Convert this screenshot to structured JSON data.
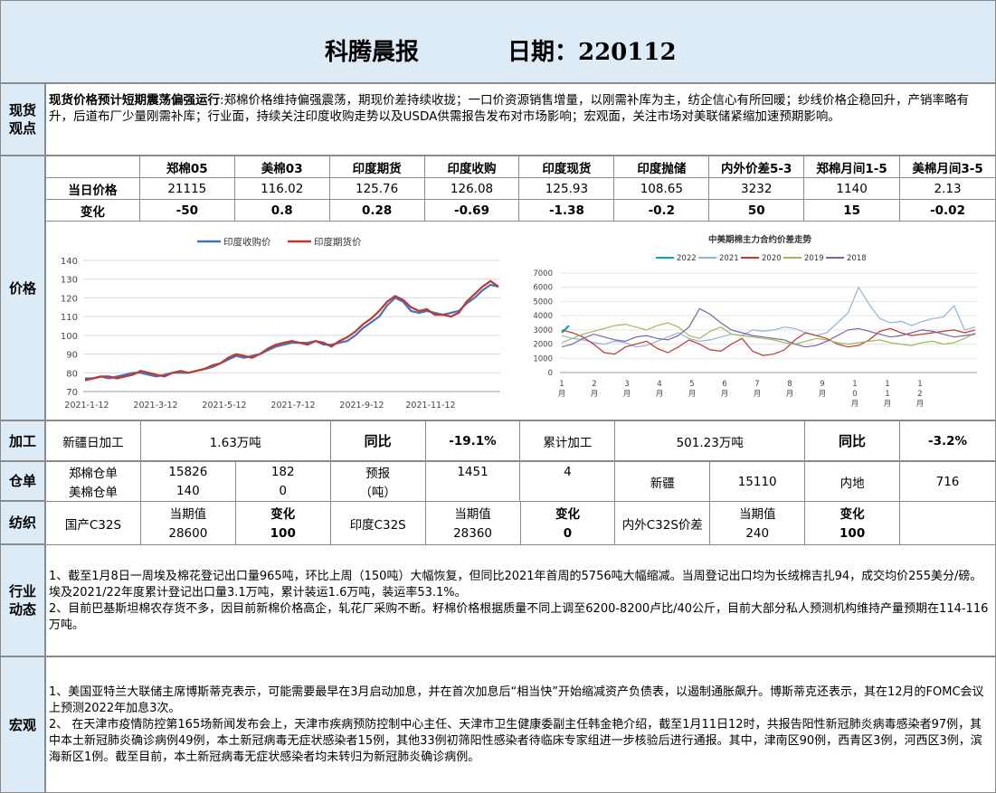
{
  "header": {
    "title": "科腾晨报",
    "date_label": "日期：220112"
  },
  "spot": {
    "label": "现货观点",
    "headline": "现货价格预计短期震荡偏强运行",
    "body": ":郑棉价格维持偏强震荡，期现价差持续收拢；一口价资源销售增量，以刚需补库为主，纺企信心有所回暖；纱线价格企稳回升，产销率略有升，后道布厂少量刚需补库；行业面，持续关注印度收购走势以及USDA供需报告发布对市场影响；宏观面，关注市场对美联储紧缩加速预期影响。"
  },
  "price_table": {
    "side_label": "价格",
    "headers": [
      "郑棉05",
      "美棉03",
      "印度期货",
      "印度收购",
      "印度现货",
      "印度抛储",
      "内外价差5-3",
      "郑棉月间1-5",
      "美棉月间3-5"
    ],
    "row1_label": "当日价格",
    "row1": [
      "21115",
      "116.02",
      "125.76",
      "126.08",
      "125.93",
      "108.65",
      "3232",
      "1140",
      "2.13"
    ],
    "row2_label": "变化",
    "row2": [
      "-50",
      "0.8",
      "0.28",
      "-0.69",
      "-1.38",
      "-0.2",
      "50",
      "15",
      "-0.02"
    ]
  },
  "chart_data": [
    {
      "type": "line",
      "title": "",
      "legend": [
        "印度收购价",
        "印度期货价"
      ],
      "legend_placement": "top",
      "colors": [
        "#4472c4",
        "#c0392b"
      ],
      "x_ticks": [
        "2021-1-12",
        "2021-3-12",
        "2021-5-12",
        "2021-7-12",
        "2021-9-12",
        "2021-11-12"
      ],
      "ylim": [
        70,
        140
      ],
      "y_ticks": [
        70,
        80,
        90,
        100,
        110,
        120,
        130,
        140
      ],
      "grid": "horizontal",
      "series": [
        {
          "name": "印度收购价",
          "values": [
            77,
            77,
            78,
            77,
            78,
            79,
            80,
            80,
            79,
            78,
            79,
            80,
            80,
            80,
            81,
            82,
            83,
            85,
            87,
            89,
            88,
            89,
            90,
            92,
            94,
            95,
            96,
            96,
            96,
            97,
            95,
            95,
            96,
            97,
            100,
            104,
            107,
            110,
            116,
            120,
            118,
            113,
            112,
            113,
            112,
            111,
            112,
            113,
            117,
            120,
            124,
            127,
            126
          ]
        },
        {
          "name": "印度期货价",
          "values": [
            76,
            77,
            78,
            78,
            77,
            78,
            79,
            81,
            80,
            79,
            78,
            80,
            81,
            80,
            81,
            82,
            84,
            85,
            88,
            90,
            89,
            88,
            90,
            93,
            95,
            96,
            97,
            96,
            95,
            97,
            96,
            94,
            97,
            99,
            102,
            106,
            109,
            113,
            118,
            121,
            119,
            115,
            113,
            114,
            111,
            111,
            110,
            112,
            118,
            122,
            126,
            129,
            126
          ]
        }
      ]
    },
    {
      "type": "line",
      "title": "中美期棉主力合约价差走势",
      "legend": [
        "2022",
        "2021",
        "2020",
        "2019",
        "2018"
      ],
      "legend_placement": "top",
      "colors": [
        "#00a3cc",
        "#8db4e2",
        "#c0392b",
        "#9bbb59",
        "#7f5fa8"
      ],
      "ylim": [
        0,
        7000
      ],
      "y_ticks": [
        0,
        1000,
        2000,
        3000,
        4000,
        5000,
        6000,
        7000
      ],
      "x_ticks": [
        "1月",
        "2月",
        "3月",
        "4月",
        "5月",
        "6月",
        "7月",
        "8月",
        "9月",
        "10月",
        "11月",
        "12月"
      ],
      "grid": "horizontal",
      "series": [
        {
          "name": "2022",
          "values": [
            2800,
            3300
          ]
        },
        {
          "name": "2021",
          "values": [
            2600,
            2400,
            2300,
            2100,
            2000,
            2200,
            2100,
            1800,
            1900,
            2200,
            2500,
            2800,
            2400,
            2200,
            2300,
            2500,
            2700,
            2600,
            3000,
            2900,
            3000,
            3200,
            3100,
            2800,
            2600,
            2800,
            3500,
            4200,
            6000,
            4800,
            3800,
            3500,
            3600,
            3300,
            3600,
            3800,
            3900,
            4700,
            3000,
            3200
          ]
        },
        {
          "name": "2020",
          "values": [
            3000,
            2800,
            2500,
            2000,
            1400,
            1300,
            1800,
            2000,
            2200,
            1700,
            1400,
            1800,
            2300,
            2000,
            1600,
            1500,
            2000,
            2400,
            1500,
            1200,
            1300,
            1600,
            2300,
            2800,
            2600,
            2400,
            2000,
            1800,
            1900,
            2300,
            2900,
            3100,
            2800,
            2600,
            2700,
            2800,
            2900,
            3000,
            2800,
            3000
          ]
        },
        {
          "name": "2019",
          "values": [
            2100,
            2400,
            2700,
            2900,
            3100,
            3300,
            3400,
            3200,
            3000,
            3300,
            3500,
            3200,
            2600,
            2400,
            2900,
            3200,
            2700,
            2600,
            2500,
            2400,
            2300,
            2100,
            2000,
            2200,
            2400,
            2300,
            2100,
            2000,
            2100,
            2200,
            2300,
            2100,
            2000,
            1900,
            2100,
            2200,
            2000,
            2100,
            2400,
            2800
          ]
        },
        {
          "name": "2018",
          "values": [
            1800,
            2000,
            2400,
            2700,
            2500,
            2300,
            2200,
            2500,
            2600,
            2400,
            2300,
            2600,
            3200,
            4500,
            4100,
            3500,
            3000,
            2800,
            2600,
            2500,
            2400,
            2300,
            2000,
            1800,
            1900,
            2200,
            2600,
            3000,
            3100,
            2900,
            2700,
            2500,
            2600,
            2800,
            3000,
            2900,
            2700,
            2500,
            2600,
            2700
          ]
        }
      ]
    }
  ],
  "processing": {
    "label": "加工",
    "xj_label": "新疆日加工",
    "xj_value": "1.63万吨",
    "yoy_label": "同比",
    "xj_yoy": "-19.1%",
    "cum_label": "累计加工",
    "cum_value": "501.23万吨",
    "yoy_label2": "同比",
    "cum_yoy": "-3.2%"
  },
  "warehouse": {
    "label": "仓单",
    "zc_label": "郑棉仓单",
    "zc_value": "15826",
    "zc_change": "182",
    "forecast_label": "预报",
    "forecast_unit": "（吨）",
    "forecast_value": "1451",
    "forecast_change": "4",
    "xj_label": "新疆",
    "xj_value": "15110",
    "nd_label": "内地",
    "nd_value": "716",
    "us_label": "美棉仓单",
    "us_value": "140",
    "us_change": "0"
  },
  "textile": {
    "label": "纺织",
    "cur_label": "当期值",
    "chg_label": "变化",
    "domestic_label": "国产C32S",
    "domestic_value": "28600",
    "domestic_change": "100",
    "india_label": "印度C32S",
    "india_value": "28360",
    "india_change": "0",
    "spread_label": "内外C32S价差",
    "spread_value": "240",
    "spread_change": "100"
  },
  "industry": {
    "label": "行业动态",
    "p1": "1、截至1月8日一周埃及棉花登记出口量965吨，环比上周（150吨）大幅恢复，但同比2021年首周的5756吨大幅缩减。当周登记出口均为长绒棉吉扎94，成交均价255美分/磅。埃及2021/22年度累计登记出口量3.1万吨，累计装运1.6万吨，装运率53.1%。",
    "p2": "2、目前巴基斯坦棉农存货不多，因目前新棉价格高企，轧花厂采购不断。籽棉价格根据质量不同上调至6200-8200卢比/40公斤，目前大部分私人预测机构维持产量预期在114-116万吨。"
  },
  "macro": {
    "label": "宏观",
    "p1": "1、美国亚特兰大联储主席博斯蒂克表示，可能需要最早在3月启动加息，并在首次加息后“相当快”开始缩减资产负债表，以遏制通胀飙升。博斯蒂克还表示，其在12月的FOMC会议上预测2022年加息3次。",
    "p2": "2、  在天津市疫情防控第165场新闻发布会上，天津市疾病预防控制中心主任、天津市卫生健康委副主任韩金艳介绍，截至1月11日12时，共报告阳性新冠肺炎病毒感染者97例，其中本土新冠肺炎确诊病例49例，本土新冠病毒无症状感染者15例，其他33例初筛阳性感染者待临床专家组进一步核验后进行通报。其中，津南区90例，西青区3例，河西区3例，滨海新区1例。截至目前，本土新冠病毒无症状感染者均未转归为新冠肺炎确诊病例。"
  }
}
